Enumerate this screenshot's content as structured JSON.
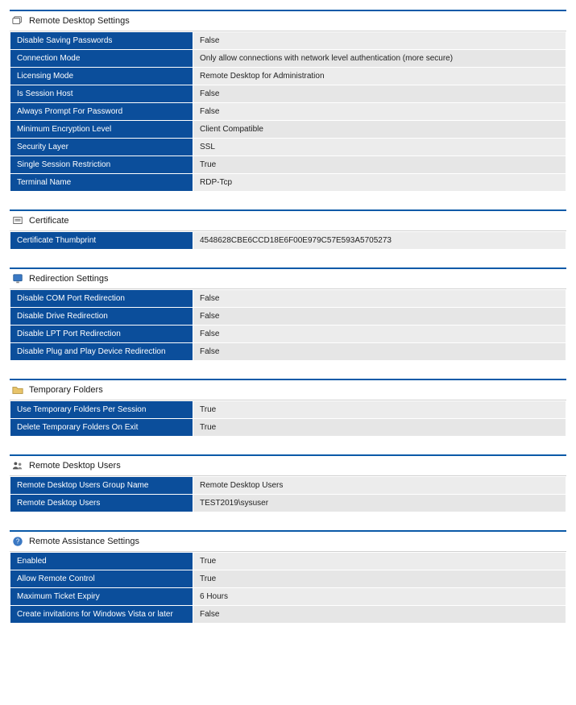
{
  "sections": [
    {
      "id": "remote-desktop-settings",
      "title": "Remote Desktop Settings",
      "icon": "remote-desktop-icon",
      "rows": [
        {
          "label": "Disable Saving Passwords",
          "value": "False"
        },
        {
          "label": "Connection Mode",
          "value": "Only allow connections with network level authentication (more secure)"
        },
        {
          "label": "Licensing Mode",
          "value": "Remote Desktop for Administration"
        },
        {
          "label": "Is Session Host",
          "value": "False"
        },
        {
          "label": "Always Prompt For Password",
          "value": "False"
        },
        {
          "label": "Minimum Encryption Level",
          "value": "Client Compatible"
        },
        {
          "label": "Security Layer",
          "value": "SSL"
        },
        {
          "label": "Single Session Restriction",
          "value": "True"
        },
        {
          "label": "Terminal Name",
          "value": "RDP-Tcp"
        }
      ]
    },
    {
      "id": "certificate",
      "title": "Certificate",
      "icon": "certificate-icon",
      "rows": [
        {
          "label": "Certificate Thumbprint",
          "value": "4548628CBE6CCD18E6F00E979C57E593A5705273"
        }
      ]
    },
    {
      "id": "redirection-settings",
      "title": "Redirection Settings",
      "icon": "monitor-icon",
      "rows": [
        {
          "label": "Disable COM Port Redirection",
          "value": "False"
        },
        {
          "label": "Disable Drive Redirection",
          "value": "False"
        },
        {
          "label": "Disable LPT Port Redirection",
          "value": "False"
        },
        {
          "label": "Disable Plug and Play Device Redirection",
          "value": "False"
        }
      ]
    },
    {
      "id": "temporary-folders",
      "title": "Temporary Folders",
      "icon": "folder-icon",
      "rows": [
        {
          "label": "Use Temporary Folders Per Session",
          "value": "True"
        },
        {
          "label": "Delete Temporary Folders On Exit",
          "value": "True"
        }
      ]
    },
    {
      "id": "remote-desktop-users",
      "title": "Remote Desktop Users",
      "icon": "users-icon",
      "rows": [
        {
          "label": "Remote Desktop Users Group Name",
          "value": "Remote Desktop Users"
        },
        {
          "label": "Remote Desktop Users",
          "value": "TEST2019\\sysuser"
        }
      ]
    },
    {
      "id": "remote-assistance-settings",
      "title": "Remote Assistance Settings",
      "icon": "help-icon",
      "rows": [
        {
          "label": "Enabled",
          "value": "True"
        },
        {
          "label": "Allow Remote Control",
          "value": "True"
        },
        {
          "label": "Maximum Ticket Expiry",
          "value": "6 Hours"
        },
        {
          "label": "Create invitations for Windows Vista or later",
          "value": "False"
        }
      ]
    }
  ],
  "colors": {
    "header_blue": "#0b5aa8",
    "cell_blue": "#0b4e9b",
    "val_bg": "#ececec"
  }
}
